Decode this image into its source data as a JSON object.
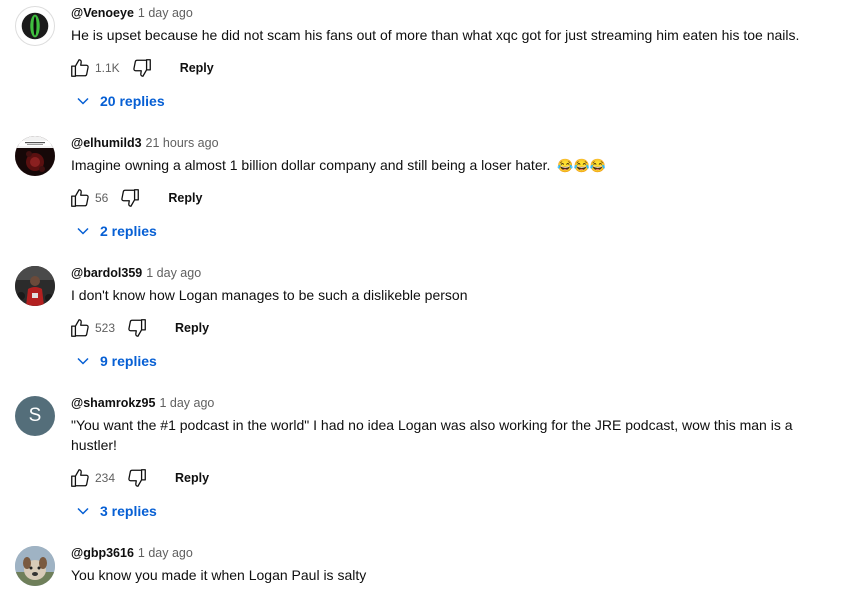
{
  "comments": [
    {
      "author": "@Venoeye",
      "time": "1 day ago",
      "text": "He is upset because he did not scam his fans out of more than what xqc got for just streaming him eaten his toe nails.",
      "likes": "1.1K",
      "reply_label": "Reply",
      "replies_label": "20 replies",
      "avatar_icon": "green-eye-avatar"
    },
    {
      "author": "@elhumild3",
      "time": "21 hours ago",
      "text": "Imagine owning a almost 1 billion dollar company and still being a loser hater.",
      "emoji": "😂😂😂",
      "likes": "56",
      "reply_label": "Reply",
      "replies_label": "2 replies",
      "avatar_icon": "dark-red-artwork-avatar"
    },
    {
      "author": "@bardol359",
      "time": "1 day ago",
      "text": "I don't know how Logan manages to be such a dislikeble person",
      "likes": "523",
      "reply_label": "Reply",
      "replies_label": "9 replies",
      "avatar_icon": "basketball-player-avatar"
    },
    {
      "author": "@shamrokz95",
      "time": "1 day ago",
      "text": "\"You want the #1 podcast in the world\" I had no idea Logan was also working for the JRE podcast, wow this man is a hustler!",
      "likes": "234",
      "reply_label": "Reply",
      "replies_label": "3 replies",
      "avatar_letter": "S",
      "avatar_color": "#546e7a"
    },
    {
      "author": "@gbp3616",
      "time": "1 day ago",
      "text": "You know you made it when Logan Paul is salty",
      "avatar_icon": "dog-photo-avatar"
    }
  ],
  "colors": {
    "link": "#065fd4",
    "muted": "#606060",
    "text": "#0f0f0f"
  }
}
